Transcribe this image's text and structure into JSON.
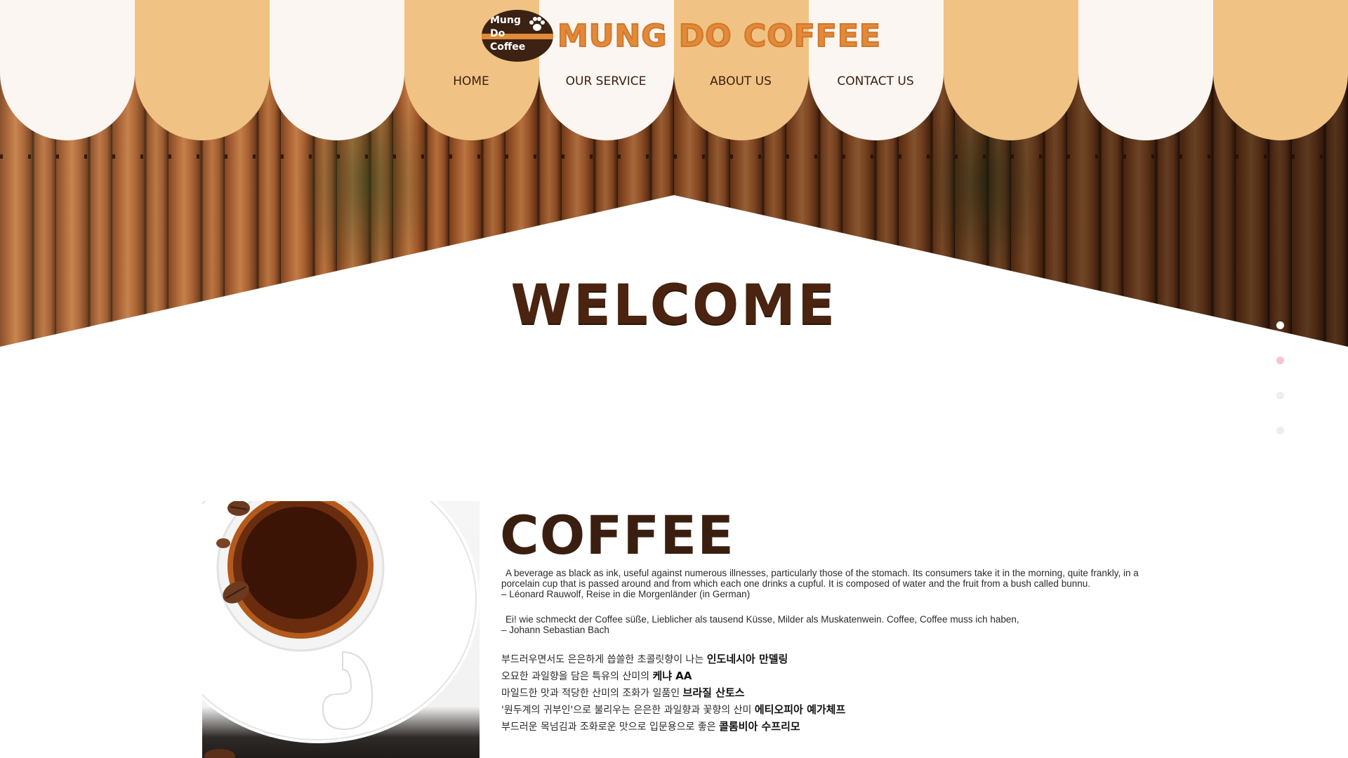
{
  "brand": {
    "logo_text": [
      "Mung",
      "Do",
      "Coffee"
    ],
    "title": "MUNG DO COFFEE"
  },
  "nav": {
    "items": [
      {
        "label": "HOME"
      },
      {
        "label": "OUR SERVICE"
      },
      {
        "label": "ABOUT US"
      },
      {
        "label": "CONTACT US"
      }
    ]
  },
  "hero": {
    "heading": "WELCOME"
  },
  "slider": {
    "dots": 4,
    "active_index": 0,
    "colors": [
      "#ffffff",
      "#f7c4cf",
      "#eeeeee",
      "#eeeeee"
    ]
  },
  "coffee": {
    "heading": "COFFEE",
    "quote1": "A beverage as black as ink, useful against numerous illnesses, particularly those of the stomach. Its consumers take it in the morning, quite frankly, in a porcelain cup that is passed around and from which each one drinks a cupful. It is composed of water and the fruit from a bush called bunnu.",
    "quote1_author": "– Léonard Rauwolf, Reise in die Morgenländer (in German)",
    "quote2": "Ei! wie schmeckt der Coffee süße, Lieblicher als tausend Küsse, Milder als Muskatenwein. Coffee, Coffee muss ich haben,",
    "quote2_author": "– Johann Sebastian Bach",
    "beans": [
      {
        "desc": "부드러우면서도 은은하게 씁쓸한 초콜릿향이 나는 ",
        "name": "인도네시아 만델링"
      },
      {
        "desc": "오묘한 과일향을 담은 특유의 산미의 ",
        "name": "케냐 AA"
      },
      {
        "desc": "마일드한 맛과 적당한 산미의 조화가 일품인 ",
        "name": "브라질 산토스"
      },
      {
        "desc": "'원두계의 귀부인'으로 불리우는 은은한 과일향과 꽃향의 산미 ",
        "name": "에티오피아 예가체프"
      },
      {
        "desc": "부드러운 목넘김과 조화로운 맛으로 입문용으로 좋은 ",
        "name": "콜롬비아 수프리모"
      }
    ]
  },
  "colors": {
    "awning_tan": "#f0c384",
    "awning_light": "#fbf6f1",
    "brand_orange": "#e08a3a",
    "dark_brown": "#3a1f10"
  }
}
